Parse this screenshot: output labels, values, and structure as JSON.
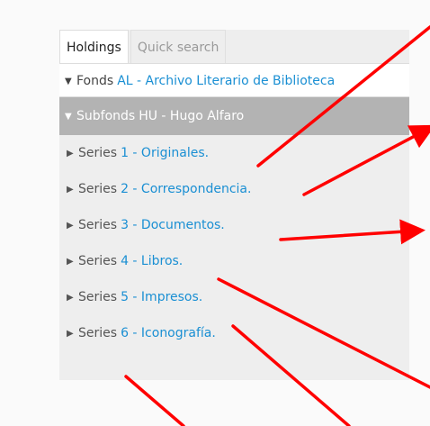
{
  "tabs": {
    "holdings": "Holdings",
    "quick_search": "Quick search"
  },
  "tree": {
    "fonds": {
      "level": "Fonds",
      "title": "AL - Archivo Literario de Biblioteca"
    },
    "subfonds": {
      "level": "Subfonds",
      "title": "HU - Hugo Alfaro"
    },
    "series": [
      {
        "level": "Series",
        "title": "1 - Originales."
      },
      {
        "level": "Series",
        "title": "2 - Correspondencia."
      },
      {
        "level": "Series",
        "title": "3 - Documentos."
      },
      {
        "level": "Series",
        "title": "4 - Libros."
      },
      {
        "level": "Series",
        "title": "5 - Impresos."
      },
      {
        "level": "Series",
        "title": "6 - Iconografía."
      }
    ]
  },
  "colors": {
    "link": "#1a8fd3",
    "annotation_arrow": "#ff0000",
    "subfonds_background": "#b3b3b3"
  }
}
